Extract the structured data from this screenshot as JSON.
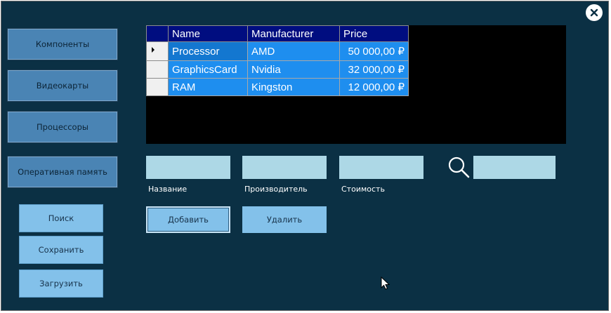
{
  "nav": {
    "components": "Компоненты",
    "gpus": "Видеокарты",
    "cpus": "Процессоры",
    "ram": "Оперативная память"
  },
  "actions": {
    "search": "Поиск",
    "save": "Сохранить",
    "load": "Загрузить"
  },
  "grid": {
    "columns": [
      "Name",
      "Manufacturer",
      "Price"
    ],
    "rows": [
      {
        "name": "Processor",
        "manufacturer": "AMD",
        "price": "50 000,00 ₽"
      },
      {
        "name": "GraphicsCard",
        "manufacturer": "Nvidia",
        "price": "32 000,00 ₽"
      },
      {
        "name": "RAM",
        "manufacturer": "Kingston",
        "price": "12 000,00 ₽"
      }
    ]
  },
  "form": {
    "name_label": "Название",
    "manufacturer_label": "Производитель",
    "price_label": "Стоимость",
    "name_value": "",
    "manufacturer_value": "",
    "price_value": "",
    "search_value": "",
    "add_label": "Добавить",
    "delete_label": "Удалить"
  },
  "icons": {
    "close": "close-icon",
    "search": "search-icon",
    "row_pointer": "row-pointer-icon",
    "cursor": "mouse-cursor-icon"
  }
}
